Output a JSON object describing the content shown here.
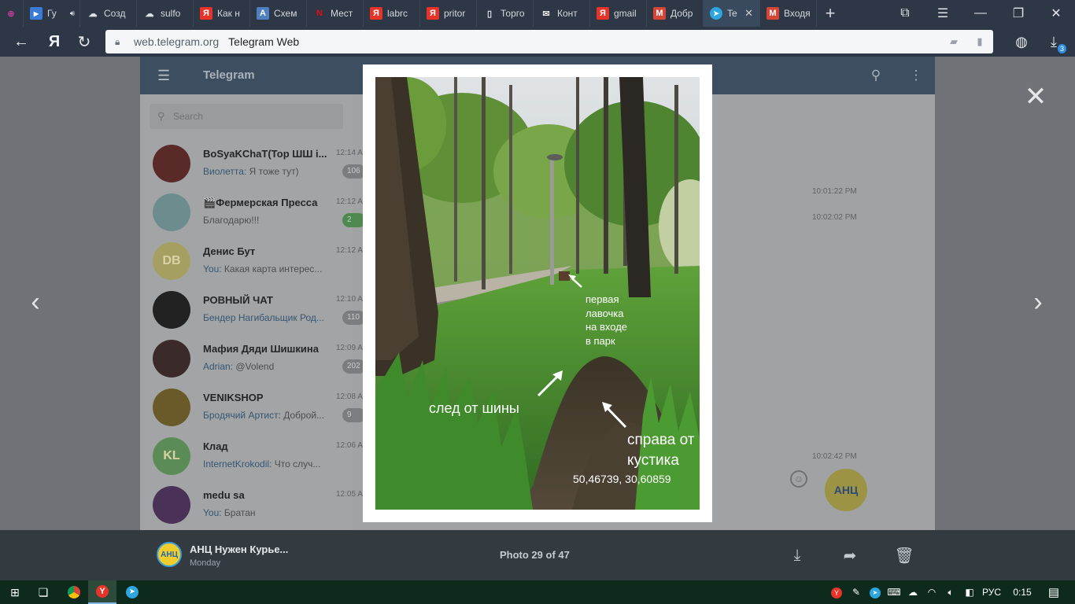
{
  "browser": {
    "tabs": [
      {
        "label": "",
        "icon": "ring-icon",
        "color": "#c03c98"
      },
      {
        "label": "Гу",
        "icon": "video-play-icon",
        "color": "#3a7bd5",
        "audio": true
      },
      {
        "label": "Созд",
        "icon": "cloud-icon",
        "color": "#dfe3e8"
      },
      {
        "label": "sulfo",
        "icon": "cloud-icon",
        "color": "#dfe3e8"
      },
      {
        "label": "Как н",
        "icon": "yandex-icon",
        "color": "#e8332a",
        "glyph": "Я"
      },
      {
        "label": "Схем",
        "icon": "app-a-icon",
        "color": "#4f7fbf",
        "glyph": "A"
      },
      {
        "label": "Мест",
        "icon": "netflix-n-icon",
        "color": "#2d3745",
        "glyph": "N"
      },
      {
        "label": "labrc",
        "icon": "yandex-icon",
        "color": "#e8332a",
        "glyph": "Я"
      },
      {
        "label": "pritor",
        "icon": "yandex-icon",
        "color": "#e8332a",
        "glyph": "Я"
      },
      {
        "label": "Торго",
        "icon": "document-icon",
        "color": "#dfe3e8"
      },
      {
        "label": "Конт",
        "icon": "envelope-icon",
        "color": "#e8e8e8"
      },
      {
        "label": "gmail",
        "icon": "yandex-icon",
        "color": "#e8332a",
        "glyph": "Я"
      },
      {
        "label": "Добр",
        "icon": "gmail-icon",
        "color": "#d44638",
        "glyph": "M"
      },
      {
        "label": "Te",
        "icon": "telegram-icon",
        "color": "#2ca5e0",
        "active": true
      },
      {
        "label": "Входя",
        "icon": "gmail-icon",
        "color": "#d44638",
        "glyph": "M"
      }
    ],
    "url": "web.telegram.org",
    "page_title": "Telegram Web",
    "download_count": "3"
  },
  "telegram": {
    "title": "Telegram",
    "search_placeholder": "Search",
    "chats": [
      {
        "name": "BoSyaKChaT(Тор ШШ і...",
        "time": "12:14 A",
        "sender": "Виолетта:",
        "message": " Я тоже тут)",
        "badge": "106",
        "avatar_color": "#5a2a28",
        "initials": ""
      },
      {
        "name": "🎬Фермерская Пресса",
        "time": "12:12 A",
        "sender": "",
        "message": "Благодарю!!!",
        "badge": "2",
        "badge_green": true,
        "avatar_color": "#6d8c8e",
        "initials": ""
      },
      {
        "name": "Денис Бут",
        "time": "12:12 A",
        "sender": "You:",
        "message": " Какая карта интерес...",
        "badge": "",
        "avatar_color": "#a69f62",
        "initials": "DB"
      },
      {
        "name": "РОВНЫЙ ЧАТ",
        "time": "12:10 A",
        "sender": "Бендер Нагибальщик Род...",
        "message": "",
        "badge": "110",
        "avatar_color": "#222222",
        "initials": ""
      },
      {
        "name": "Мафия Дяди Шишкина",
        "time": "12:09 A",
        "sender": "Adrian:",
        "message": " @Volend",
        "badge": "202",
        "avatar_color": "#3b2a2a",
        "initials": ""
      },
      {
        "name": "VENIKSHOP",
        "time": "12:08 A",
        "sender": "Бродячий Артист:",
        "message": " Доброй...",
        "badge": "9",
        "avatar_color": "#6a5a2a",
        "initials": ""
      },
      {
        "name": "Клад",
        "time": "12:06 A",
        "sender": "InternetKrokodil:",
        "message": " Что случ...",
        "badge": "",
        "avatar_color": "#5b8b56",
        "initials": "KL"
      },
      {
        "name": "medu sa",
        "time": "12:05 A",
        "sender": "You:",
        "message": " Братан",
        "badge": "",
        "avatar_color": "#4a3158",
        "initials": ""
      }
    ],
    "message_times": [
      "10:01:22 PM",
      "10:02:02 PM",
      "10:02:42 PM"
    ],
    "channel_avatar_text": "АНЦ"
  },
  "photo": {
    "annotations": {
      "bench": [
        "первая",
        "лавочка",
        "на входе",
        "в парк"
      ],
      "tire": "след от шины",
      "bush": [
        "справа от",
        "кустика"
      ],
      "coords": "50,46739, 30,60859"
    }
  },
  "media_bar": {
    "channel_name": "АНЦ Нужен Курье...",
    "date": "Monday",
    "counter": "Photo 29 of 47",
    "avatar_text": "АНЦ"
  },
  "taskbar": {
    "language": "РУС",
    "clock": "0:15"
  }
}
